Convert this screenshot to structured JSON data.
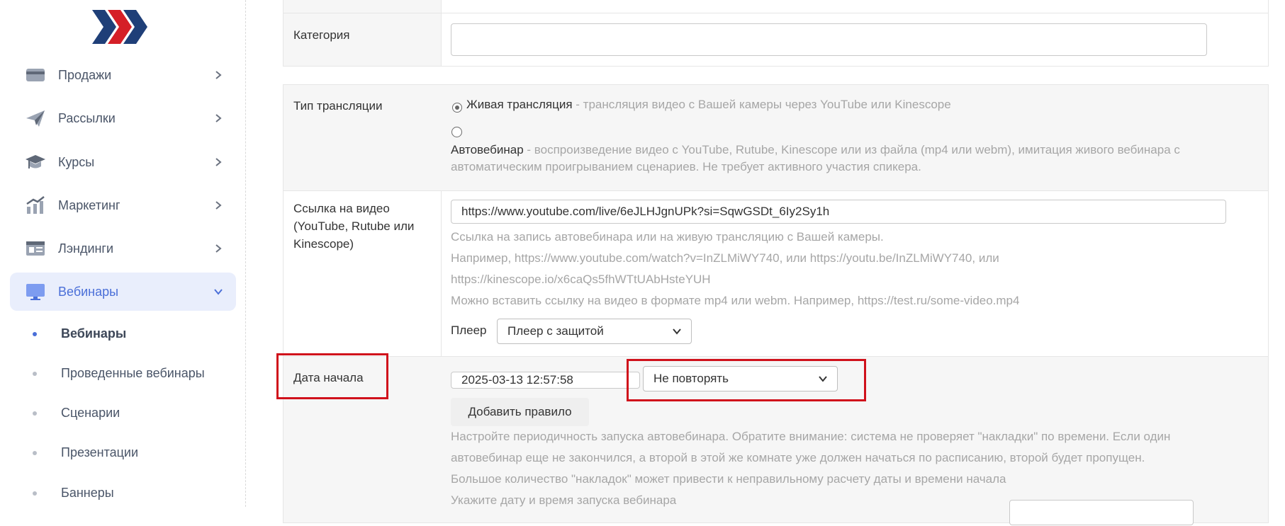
{
  "sidebar": {
    "items": [
      {
        "label": "Продажи",
        "icon": "card-icon"
      },
      {
        "label": "Рассылки",
        "icon": "paper-plane-icon"
      },
      {
        "label": "Курсы",
        "icon": "graduation-cap-icon"
      },
      {
        "label": "Маркетинг",
        "icon": "chart-bars-icon"
      },
      {
        "label": "Лэндинги",
        "icon": "landing-page-icon"
      },
      {
        "label": "Вебинары",
        "icon": "monitor-icon",
        "active": true
      }
    ],
    "subitems": [
      {
        "label": "Вебинары",
        "active": true
      },
      {
        "label": "Проведенные вебинары"
      },
      {
        "label": "Сценарии"
      },
      {
        "label": "Презентации"
      },
      {
        "label": "Баннеры"
      }
    ]
  },
  "form": {
    "category": {
      "label": "Категория",
      "value": ""
    },
    "broadcast_type": {
      "label": "Тип трансляции",
      "options": [
        {
          "title": "Живая трансляция",
          "desc": " - трансляция видео с Вашей камеры через YouTube или Kinescope",
          "checked": true
        },
        {
          "title": "Автовебинар",
          "desc": " - воспроизведение видео с YouTube, Rutube, Kinescope или из файла (mp4 или webm), имитация живого вебинара с",
          "desc2": "автоматическим проигрыванием сценариев. Не требует активного участия спикера.",
          "checked": false
        }
      ]
    },
    "video_link": {
      "label_lines": [
        "Ссылка на видео",
        "(YouTube, Rutube или",
        "Kinescope)"
      ],
      "value": "https://www.youtube.com/live/6eJLHJgnUPk?si=SqwGSDt_6Iy2Sy1h",
      "help_lines": [
        "Ссылка на запись автовебинара или на живую трансляцию с Вашей камеры.",
        "Например, https://www.youtube.com/watch?v=InZLMiWY740, или https://youtu.be/InZLMiWY740, или",
        "https://kinescope.io/x6caQs5fhWTtUAbHsteYUH",
        "Можно вставить ссылку на видео в формате mp4 или webm. Например, https://test.ru/some-video.mp4"
      ],
      "player_label": "Плеер",
      "player_value": "Плеер с защитой"
    },
    "start_date": {
      "label": "Дата начала",
      "value": "2025-03-13 12:57:58",
      "repeat_value": "Не повторять",
      "add_rule_label": "Добавить правило",
      "help_lines": [
        "Настройте периодичность запуска автовебинара. Обратите внимание: система не проверяет \"накладки\" по времени. Если один",
        "автовебинар еще не закончился, а второй в этой же комнате уже должен начаться по расписанию, второй будет пропущен.",
        "Большое количество \"накладок\" может привести к неправильному расчету даты и времени начала"
      ],
      "cut_text": "Укажите дату и время запуска вебинара"
    }
  },
  "colors": {
    "highlight": "#d0111b",
    "accent": "#4a6fd8"
  }
}
